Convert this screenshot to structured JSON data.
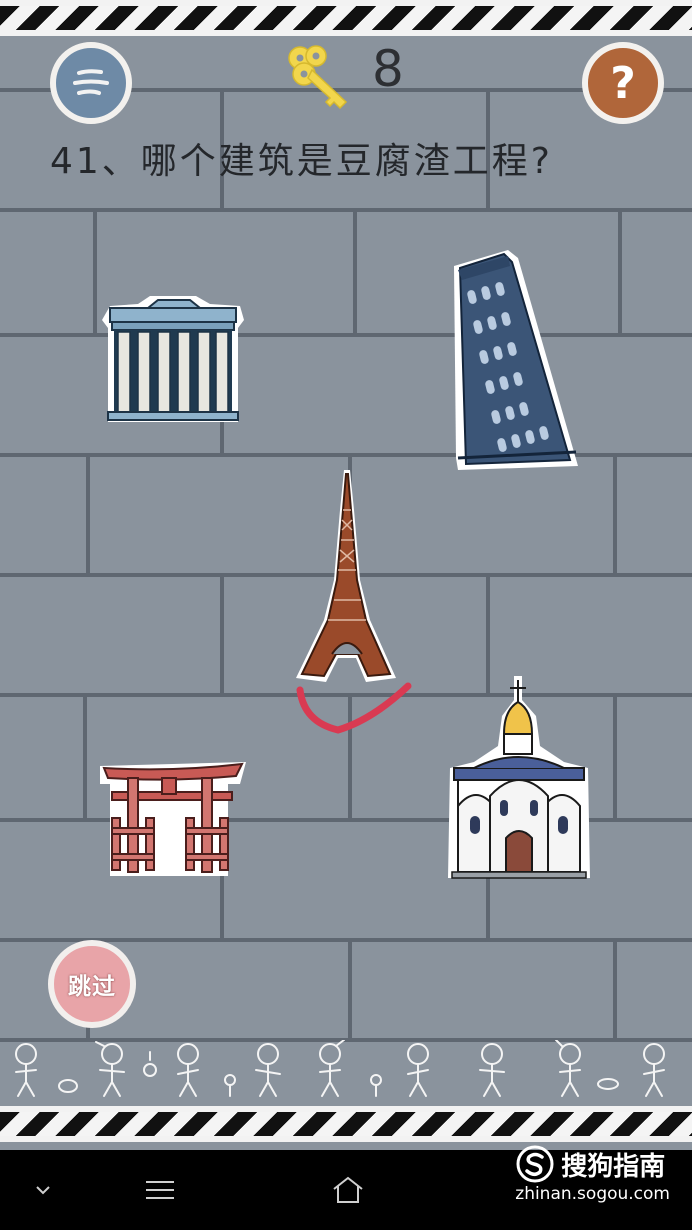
{
  "header": {
    "key_count": "8",
    "question": "41、哪个建筑是豆腐渣工程?"
  },
  "buttons": {
    "help_label": "?",
    "skip_label": "跳过"
  },
  "buildings": [
    {
      "name": "parthenon",
      "selected": false
    },
    {
      "name": "leaning-tower-of-pisa",
      "selected": false
    },
    {
      "name": "eiffel-tower",
      "selected": true
    },
    {
      "name": "torii-gate",
      "selected": false
    },
    {
      "name": "orthodox-church",
      "selected": false
    }
  ],
  "watermark": {
    "title": "搜狗指南",
    "url": "zhinan.sogou.com"
  },
  "colors": {
    "wall": "#8a939d",
    "mortar": "#5f6771",
    "check_mark": "#d93a52",
    "menu_button": "#6e8aa6",
    "help_button": "#b0663a",
    "skip_button": "#e8a4a8",
    "key": "#f2d64c"
  }
}
